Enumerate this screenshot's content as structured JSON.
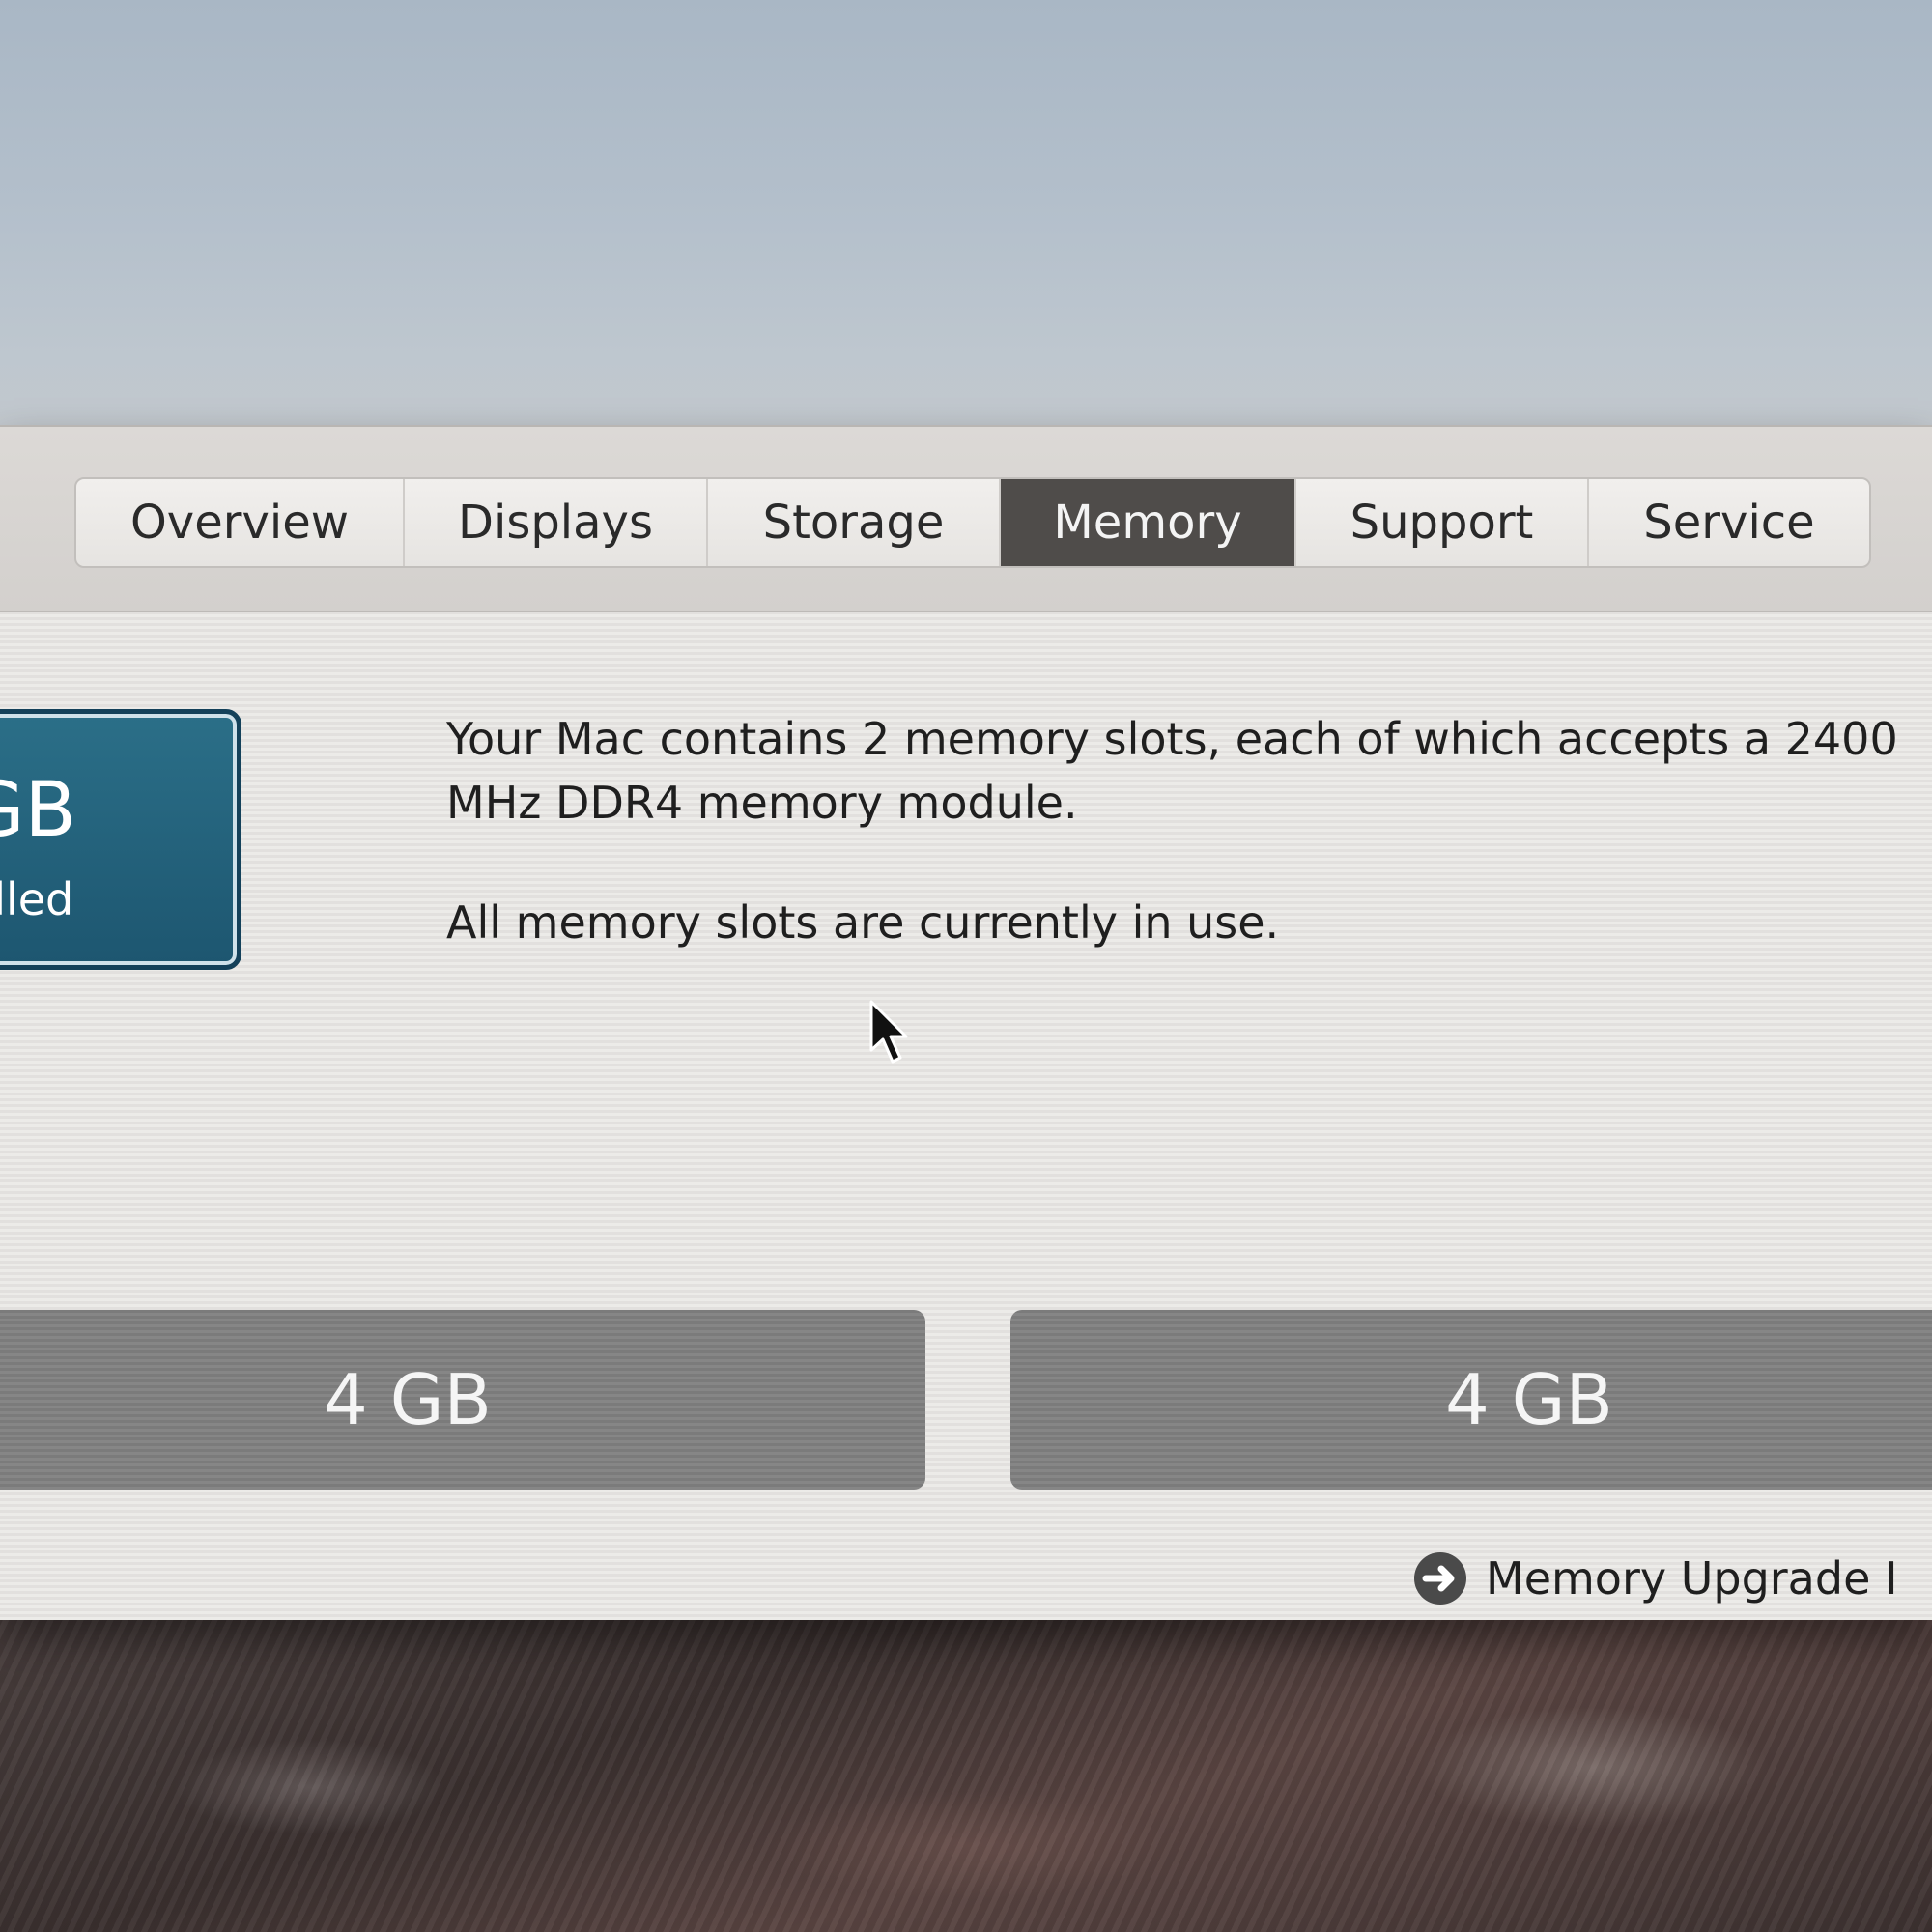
{
  "tabs": [
    {
      "label": "Overview",
      "active": false
    },
    {
      "label": "Displays",
      "active": false
    },
    {
      "label": "Storage",
      "active": false
    },
    {
      "label": "Memory",
      "active": true
    },
    {
      "label": "Support",
      "active": false
    },
    {
      "label": "Service",
      "active": false
    }
  ],
  "memory_summary": {
    "size_text": "GB",
    "label_text": "alled"
  },
  "description": {
    "line1": "Your Mac contains 2 memory slots, each of which accepts a 2400 MHz DDR4 memory module.",
    "line2": "All memory slots are currently in use."
  },
  "slots": [
    {
      "size": "4 GB"
    },
    {
      "size": "4 GB"
    }
  ],
  "upgrade_link": {
    "label": "Memory Upgrade I"
  },
  "icons": {
    "upgrade": "arrow-circle-icon",
    "cursor": "mouse-pointer-icon"
  },
  "colors": {
    "active_tab": "#4f4c4a",
    "memory_box": "#1d5670",
    "slot": "#808080"
  }
}
